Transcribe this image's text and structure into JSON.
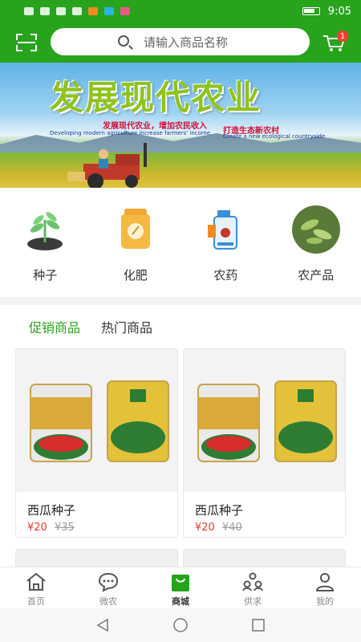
{
  "status_bar": {
    "time": "9:05",
    "icons": [
      "sim-icon",
      "wifi-icon",
      "download-icon",
      "search-icon",
      "app-icon",
      "app-icon",
      "app-icon",
      "battery-icon"
    ]
  },
  "header": {
    "search_placeholder": "请输入商品名称",
    "cart_badge": "1"
  },
  "banner": {
    "title": "发展现代农业",
    "subtitle_left": "发展现代农业，增加农民收入",
    "subtitle_right": "打造生态新农村",
    "english_left": "Developing modern agriculture increase farmers' income",
    "english_right": "Create a new ecological countryside"
  },
  "categories": [
    {
      "label": "种子",
      "icon": "seedling-icon"
    },
    {
      "label": "化肥",
      "icon": "fertilizer-bag-icon"
    },
    {
      "label": "农药",
      "icon": "pesticide-sprayer-icon"
    },
    {
      "label": "农产品",
      "icon": "soybean-icon"
    }
  ],
  "tabs": {
    "promo": "促销商品",
    "hot": "热门商品"
  },
  "products": [
    {
      "name": "西瓜种子",
      "price": "¥20",
      "old_price": "¥35"
    },
    {
      "name": "西瓜种子",
      "price": "¥20",
      "old_price": "¥40"
    }
  ],
  "tabbar": [
    {
      "label": "首页",
      "icon": "home-icon"
    },
    {
      "label": "微农",
      "icon": "chat-bubble-icon"
    },
    {
      "label": "商城",
      "icon": "shopping-bag-icon"
    },
    {
      "label": "供求",
      "icon": "supply-demand-icon"
    },
    {
      "label": "我的",
      "icon": "user-icon"
    }
  ],
  "colors": {
    "brand_green": "#27a31c",
    "price_red": "#e23b2e",
    "badge_red": "#ff3b30"
  }
}
